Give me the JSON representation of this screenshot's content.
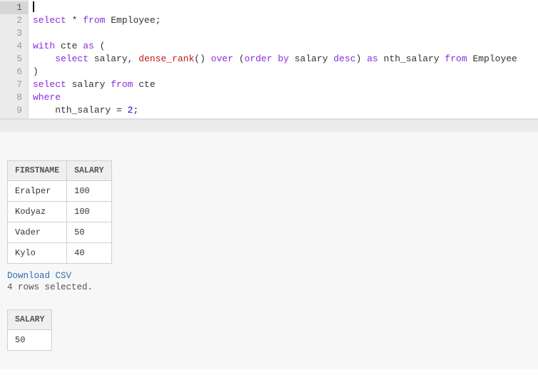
{
  "editor": {
    "active_line": 1,
    "lines": [
      {
        "n": 1,
        "tokens": [
          [
            "cursor",
            ""
          ]
        ]
      },
      {
        "n": 2,
        "tokens": [
          [
            "kw",
            "select"
          ],
          [
            "op",
            " * "
          ],
          [
            "kw",
            "from"
          ],
          [
            "id",
            " Employee"
          ],
          [
            "op",
            ";"
          ]
        ]
      },
      {
        "n": 3,
        "tokens": []
      },
      {
        "n": 4,
        "tokens": [
          [
            "kw",
            "with"
          ],
          [
            "id",
            " cte "
          ],
          [
            "kw",
            "as"
          ],
          [
            "op",
            " ("
          ]
        ]
      },
      {
        "n": 5,
        "tokens": [
          [
            "op",
            "    "
          ],
          [
            "kw",
            "select"
          ],
          [
            "id",
            " salary"
          ],
          [
            "op",
            ", "
          ],
          [
            "fn",
            "dense_rank"
          ],
          [
            "op",
            "() "
          ],
          [
            "kw",
            "over"
          ],
          [
            "op",
            " ("
          ],
          [
            "kw",
            "order"
          ],
          [
            "op",
            " "
          ],
          [
            "kw",
            "by"
          ],
          [
            "id",
            " salary "
          ],
          [
            "kw",
            "desc"
          ],
          [
            "op",
            ") "
          ],
          [
            "kw",
            "as"
          ],
          [
            "id",
            " nth_salary "
          ],
          [
            "kw",
            "from"
          ],
          [
            "id",
            " Employee"
          ]
        ]
      },
      {
        "n": 6,
        "tokens": [
          [
            "op",
            ")"
          ]
        ]
      },
      {
        "n": 7,
        "tokens": [
          [
            "kw",
            "select"
          ],
          [
            "id",
            " salary "
          ],
          [
            "kw",
            "from"
          ],
          [
            "id",
            " cte"
          ]
        ]
      },
      {
        "n": 8,
        "tokens": [
          [
            "kw",
            "where"
          ]
        ]
      },
      {
        "n": 9,
        "tokens": [
          [
            "id",
            "    nth_salary "
          ],
          [
            "op",
            "= "
          ],
          [
            "num",
            "2"
          ],
          [
            "op",
            ";"
          ]
        ]
      }
    ]
  },
  "results": {
    "table1": {
      "headers": [
        "FIRSTNAME",
        "SALARY"
      ],
      "rows": [
        [
          "Eralper",
          "100"
        ],
        [
          "Kodyaz",
          "100"
        ],
        [
          "Vader",
          "50"
        ],
        [
          "Kylo",
          "40"
        ]
      ]
    },
    "download_label": "Download CSV",
    "status": "4 rows selected.",
    "table2": {
      "headers": [
        "SALARY"
      ],
      "rows": [
        [
          "50"
        ]
      ]
    }
  }
}
